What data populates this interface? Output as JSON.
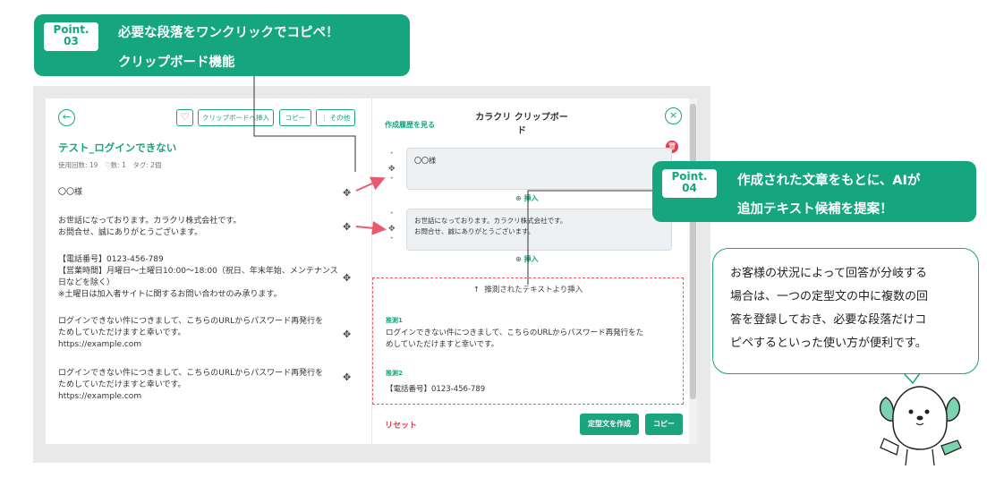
{
  "callout3": {
    "badge_top": "Point.",
    "badge_num": "03",
    "line1": "必要な段落をワンクリックでコピペ！",
    "line2": "クリップボード機能"
  },
  "callout4": {
    "badge_top": "Point.",
    "badge_num": "04",
    "line1": "作成された文章をもとに、AIが",
    "line2": "追加テキスト候補を提案！"
  },
  "speech": {
    "lines": [
      "お客様の状況によって回答が分岐する",
      "場合は、一つの定型文の中に複数の回",
      "答を登録しておき、必要な段落だけコ",
      "ピペするといった使い方が便利です。"
    ]
  },
  "left": {
    "toolbar": {
      "clipboard_label": "クリップボードへ挿入",
      "copy_label": "コピー",
      "more_label": "⋮ その他"
    },
    "title": "テスト_ログインできない",
    "meta": "使用回数: 19　♡数: 1　タグ: 2個",
    "paragraphs": [
      [
        "〇〇様"
      ],
      [
        "お世話になっております。カラクリ株式会社です。",
        "お問合せ、誠にありがとうございます。"
      ],
      [
        "【電話番号】0123-456-789",
        "【営業時間】月曜日～土曜日10:00～18:00（祝日、年末年始、メンテナンス",
        "日などを除く）",
        "※土曜日は加入者サイトに関するお問い合わせのみ承ります。"
      ],
      [
        "ログインできない件につきまして、こちらのURLからパスワード再発行を",
        "ためしていただけますと幸いです。",
        "https://example.com"
      ],
      [
        "ログインできない件につきまして、こちらのURLからパスワード再発行を",
        "ためしていただけますと幸いです。",
        "https://example.com"
      ]
    ]
  },
  "right": {
    "history_link": "作成履歴を見る",
    "title_line1": "カラクリ クリップボー",
    "title_line2": "ド",
    "card1_text": "〇〇様",
    "card2_lines": [
      "お世話になっております。カラクリ株式会社です。",
      "お問合せ、誠にありがとうございます。"
    ],
    "insert_label": "挿入",
    "suggest_header": "推測されたテキストより挿入",
    "guess1_label": "推測1",
    "guess1_lines": [
      "ログインできない件につきまして、こちらのURLからパスワード再発行をた",
      "めしていただけますと幸いです。"
    ],
    "guess2_label": "推測2",
    "guess2_text": "【電話番号】0123-456-789",
    "reset_label": "リセット",
    "create_label": "定型文を作成",
    "copy_label": "コピー"
  },
  "colors": {
    "accent": "#15a67f",
    "arrow": "#e95a6f",
    "delete": "#e0404e"
  }
}
